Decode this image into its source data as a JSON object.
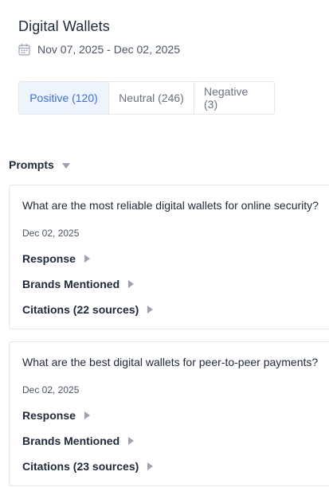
{
  "header": {
    "title": "Digital Wallets",
    "date_range": "Nov 07, 2025 - Dec 02, 2025",
    "date_icon": "calendar-icon"
  },
  "tabs": [
    {
      "label": "Positive (120)",
      "active": true
    },
    {
      "label": "Neutral (246)",
      "active": false
    },
    {
      "label": "Negative (3)",
      "active": false
    }
  ],
  "prompts": {
    "label": "Prompts",
    "items": [
      {
        "question": "What are the most reliable digital wallets for online security?",
        "date": "Dec 02, 2025",
        "response_label": "Response",
        "brands_label": "Brands Mentioned",
        "citations_label": "Citations (22 sources)"
      },
      {
        "question": "What are the best digital wallets for peer-to-peer payments?",
        "date": "Dec 02, 2025",
        "response_label": "Response",
        "brands_label": "Brands Mentioned",
        "citations_label": "Citations (23 sources)"
      }
    ]
  },
  "colors": {
    "accent": "#3b6fd6",
    "active_tab_bg": "#eef4fd",
    "border": "#e5e7eb",
    "caret": "#9ca3af"
  }
}
